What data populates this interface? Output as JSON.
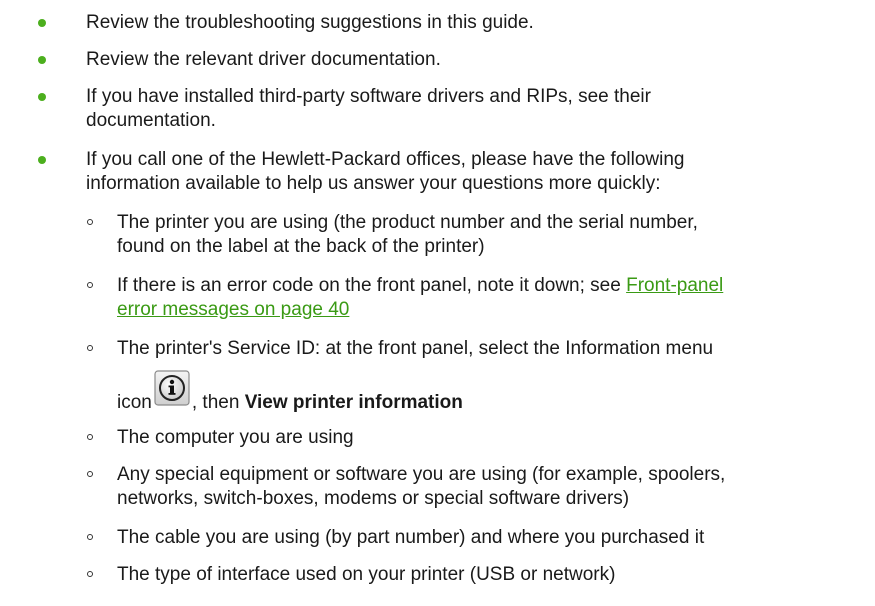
{
  "items": [
    {
      "text": "Review the troubleshooting suggestions in this guide."
    },
    {
      "text": "Review the relevant driver documentation."
    },
    {
      "line1": "If you have installed third-party software drivers and RIPs, see their",
      "line2": "documentation."
    },
    {
      "line1": "If you call one of the Hewlett-Packard offices, please have the following",
      "line2": "information available to help us answer your questions more quickly:"
    }
  ],
  "subitems": [
    {
      "line1": "The printer you are using (the product number and the serial number,",
      "line2": "found on the label at the back of the printer)"
    },
    {
      "line1_prefix": "If there is an error code on the front panel, note it down; see ",
      "link_line1": "Front-panel",
      "link_line2": "error messages on page 40"
    },
    {
      "line1": "The printer's Service ID: at the front panel, select the Information menu",
      "line2_prefix": "icon",
      "line2_mid": ", then ",
      "line2_bold": "View printer information",
      "icon": "information-icon"
    },
    {
      "text": "The computer you are using"
    },
    {
      "line1": "Any special equipment or software you are using (for example, spoolers,",
      "line2": "networks, switch-boxes, modems or special software drivers)"
    },
    {
      "text": "The cable you are using (by part number) and where you purchased it"
    },
    {
      "text": "The type of interface used on your printer (USB or network)"
    }
  ],
  "colors": {
    "bullet": "#4caf1e",
    "link": "#3a9a14",
    "text": "#1a1a1a"
  }
}
